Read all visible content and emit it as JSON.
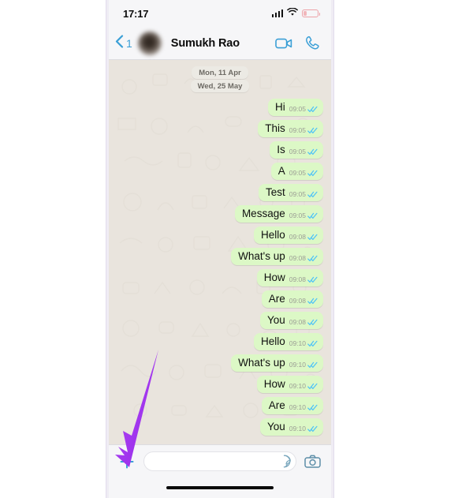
{
  "status_bar": {
    "time": "17:17",
    "signal_icon": "cellular-signal-icon",
    "wifi_icon": "wifi-icon",
    "battery_icon": "battery-low-icon"
  },
  "header": {
    "back_icon": "back-chevron-icon",
    "back_count": "1",
    "avatar": "contact-avatar-blurred",
    "contact_name": "Sumukh Rao",
    "video_call_icon": "video-camera-icon",
    "voice_call_icon": "phone-handset-icon"
  },
  "chat": {
    "date_chips": [
      "Mon, 11 Apr",
      "Wed, 25 May"
    ],
    "messages": [
      {
        "text": "Hi",
        "time": "09:05",
        "status": "read"
      },
      {
        "text": "This",
        "time": "09:05",
        "status": "read"
      },
      {
        "text": "Is",
        "time": "09:05",
        "status": "read"
      },
      {
        "text": "A",
        "time": "09:05",
        "status": "read"
      },
      {
        "text": "Test",
        "time": "09:05",
        "status": "read"
      },
      {
        "text": "Message",
        "time": "09:05",
        "status": "read"
      },
      {
        "text": "Hello",
        "time": "09:08",
        "status": "read"
      },
      {
        "text": "What's up",
        "time": "09:08",
        "status": "read"
      },
      {
        "text": "How",
        "time": "09:08",
        "status": "read"
      },
      {
        "text": "Are",
        "time": "09:08",
        "status": "read"
      },
      {
        "text": "You",
        "time": "09:08",
        "status": "read"
      },
      {
        "text": "Hello",
        "time": "09:10",
        "status": "read"
      },
      {
        "text": "What's up",
        "time": "09:10",
        "status": "read"
      },
      {
        "text": "How",
        "time": "09:10",
        "status": "read"
      },
      {
        "text": "Are",
        "time": "09:10",
        "status": "read"
      },
      {
        "text": "You",
        "time": "09:10",
        "status": "read"
      }
    ]
  },
  "input_bar": {
    "plus_icon": "plus-attachment-icon",
    "input_value": "",
    "input_placeholder": "",
    "sticker_icon": "sticker-icon",
    "camera_icon": "camera-icon",
    "mic_icon": "microphone-icon"
  },
  "annotation": {
    "arrow_icon": "purple-arrow-annotation",
    "arrow_color": "#a435f0"
  },
  "colors": {
    "bubble_outgoing": "#dcf8c6",
    "chat_background": "#e9e4dd",
    "header_background": "#f6f6f8",
    "accent_blue": "#3a9fd6",
    "tick_blue": "#4fc3f7",
    "annotation_purple": "#a435f0"
  }
}
